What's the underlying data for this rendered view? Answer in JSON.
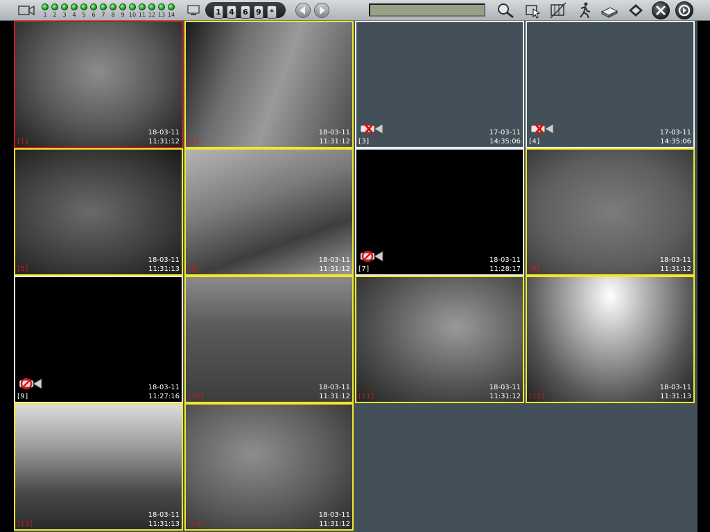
{
  "toolbar": {
    "channel_numbers": [
      "1",
      "2",
      "3",
      "4",
      "5",
      "6",
      "7",
      "8",
      "9",
      "10",
      "11",
      "12",
      "13",
      "14"
    ],
    "layout_buttons": [
      "1",
      "4",
      "6",
      "9",
      "*"
    ],
    "status_text": ""
  },
  "colors": {
    "selected_border": "#d21818",
    "active_border": "#f0e82a",
    "idle_border": "#f0f0f0",
    "background": "#435059"
  },
  "cameras": [
    {
      "label": "[1]",
      "date": "18-03-11",
      "time": "11:31:12",
      "state": "selected"
    },
    {
      "label": "[2]",
      "date": "18-03-11",
      "time": "11:31:12",
      "state": "active"
    },
    {
      "label": "[3]",
      "date": "17-03-11",
      "time": "14:35:06",
      "state": "disconnected"
    },
    {
      "label": "[4]",
      "date": "17-03-11",
      "time": "14:35:06",
      "state": "disconnected"
    },
    {
      "label": "[5]",
      "date": "18-03-11",
      "time": "11:31:13",
      "state": "active"
    },
    {
      "label": "[6]",
      "date": "18-03-11",
      "time": "11:31:12",
      "state": "active"
    },
    {
      "label": "[7]",
      "date": "18-03-11",
      "time": "11:28:17",
      "state": "no-signal"
    },
    {
      "label": "[8]",
      "date": "18-03-11",
      "time": "11:31:12",
      "state": "active"
    },
    {
      "label": "[9]",
      "date": "18-03-11",
      "time": "11:27:16",
      "state": "no-signal"
    },
    {
      "label": "[10]",
      "date": "18-03-11",
      "time": "11:31:12",
      "state": "active"
    },
    {
      "label": "[11]",
      "date": "18-03-11",
      "time": "11:31:12",
      "state": "active"
    },
    {
      "label": "[12]",
      "date": "18-03-11",
      "time": "11:31:13",
      "state": "active"
    },
    {
      "label": "[13]",
      "date": "18-03-11",
      "time": "11:31:13",
      "state": "active"
    },
    {
      "label": "[14]",
      "date": "18-03-11",
      "time": "11:31:12",
      "state": "active"
    }
  ]
}
